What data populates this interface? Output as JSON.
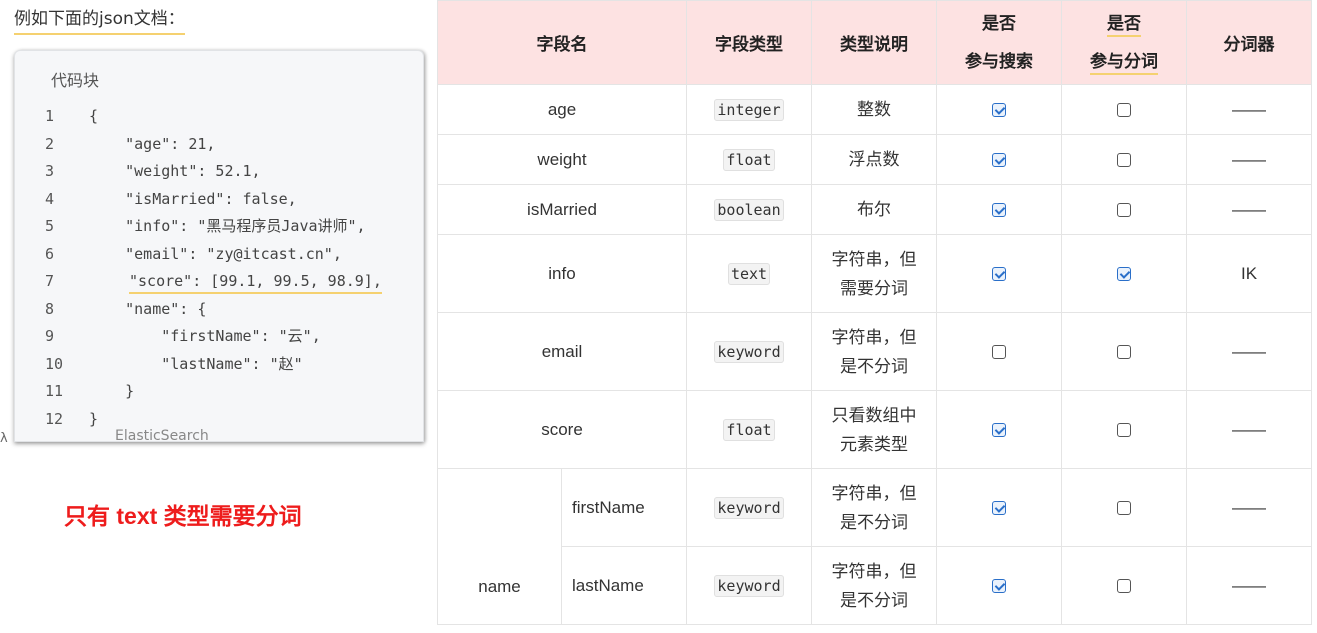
{
  "left": {
    "intro": "例如下面的json文档：",
    "code_title": "代码块",
    "under_text": "ElasticSearch",
    "under_mark": "λ",
    "red_note": "只有 text 类型需要分词",
    "lines": [
      {
        "n": "1",
        "t": "{"
      },
      {
        "n": "2",
        "t": "    \"age\": 21,"
      },
      {
        "n": "3",
        "t": "    \"weight\": 52.1,"
      },
      {
        "n": "4",
        "t": "    \"isMarried\": false,"
      },
      {
        "n": "5",
        "t": "    \"info\": \"黑马程序员Java讲师\","
      },
      {
        "n": "6",
        "t": "    \"email\": \"zy@itcast.cn\","
      },
      {
        "n": "7",
        "t": "\"score\": [99.1, 99.5, 98.9],"
      },
      {
        "n": "8",
        "t": "    \"name\": {"
      },
      {
        "n": "9",
        "t": "        \"firstName\": \"云\","
      },
      {
        "n": "10",
        "t": "        \"lastName\": \"赵\""
      },
      {
        "n": "11",
        "t": "    }"
      },
      {
        "n": "12",
        "t": "}"
      }
    ]
  },
  "table": {
    "headers": {
      "field": "字段名",
      "type": "字段类型",
      "desc": "类型说明",
      "search_1": "是否",
      "search_2": "参与搜索",
      "analyze_1": "是否",
      "analyze_2": "参与分词",
      "analyzer": "分词器"
    },
    "rows": [
      {
        "field": "age",
        "type": "integer",
        "desc1": "整数",
        "desc2": "",
        "search": true,
        "analyze": false,
        "analyzer": "——"
      },
      {
        "field": "weight",
        "type": "float",
        "desc1": "浮点数",
        "desc2": "",
        "search": true,
        "analyze": false,
        "analyzer": "——"
      },
      {
        "field": "isMarried",
        "type": "boolean",
        "desc1": "布尔",
        "desc2": "",
        "search": true,
        "analyze": false,
        "analyzer": "——"
      },
      {
        "field": "info",
        "type": "text",
        "desc1": "字符串，但",
        "desc2": "需要分词",
        "search": true,
        "analyze": true,
        "analyzer": "IK"
      },
      {
        "field": "email",
        "type": "keyword",
        "desc1": "字符串，但",
        "desc2": "是不分词",
        "search": false,
        "analyze": false,
        "analyzer": "——"
      },
      {
        "field": "score",
        "type": "float",
        "desc1": "只看数组中",
        "desc2": "元素类型",
        "search": true,
        "analyze": false,
        "analyzer": "——"
      }
    ],
    "name_group": {
      "field": "name",
      "children": [
        {
          "field": "firstName",
          "type": "keyword",
          "desc1": "字符串，但",
          "desc2": "是不分词",
          "search": true,
          "analyze": false,
          "analyzer": "——"
        },
        {
          "field": "lastName",
          "type": "keyword",
          "desc1": "字符串，但",
          "desc2": "是不分词",
          "search": true,
          "analyze": false,
          "analyzer": "——"
        }
      ]
    }
  }
}
